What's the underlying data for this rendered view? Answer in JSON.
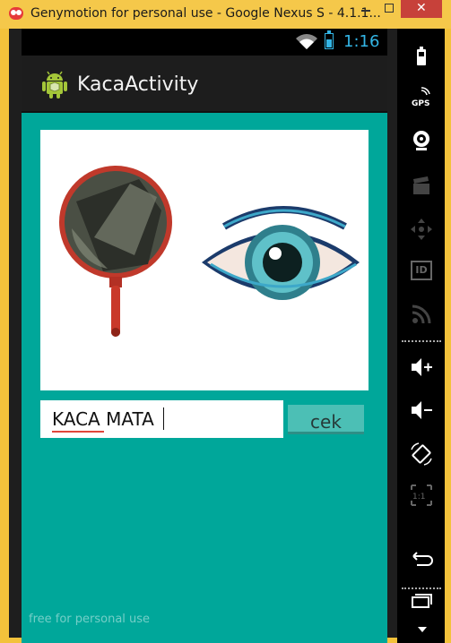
{
  "window": {
    "title": "Genymotion for personal use - Google Nexus S - 4.1.1...",
    "close_glyph": "✕"
  },
  "status_bar": {
    "time": "1:16",
    "icons": [
      "wifi-icon",
      "battery-icon"
    ],
    "accent_color": "#33b5e5"
  },
  "action_bar": {
    "app_icon": "android-icon",
    "title": "KacaActivity"
  },
  "content": {
    "background_color": "#00a79a",
    "image_description_icons": [
      "hand-mirror-image",
      "eye-image"
    ],
    "input": {
      "value": "KACA MATA",
      "placeholder": ""
    },
    "button": {
      "label": "cek"
    },
    "watermark": "free for personal use"
  },
  "sidebar": {
    "items": [
      "battery-icon",
      "gps-icon",
      "webcam-icon",
      "clapper-icon",
      "dpad-icon",
      "id-icon",
      "rss-icon",
      "volume-up-icon",
      "volume-down-icon",
      "rotate-icon",
      "ratio-icon",
      "back-icon",
      "recent-apps-icon",
      "scroll-down-icon"
    ],
    "gps_label": "GPS",
    "id_label": "ID",
    "ratio_label": "1:1"
  }
}
